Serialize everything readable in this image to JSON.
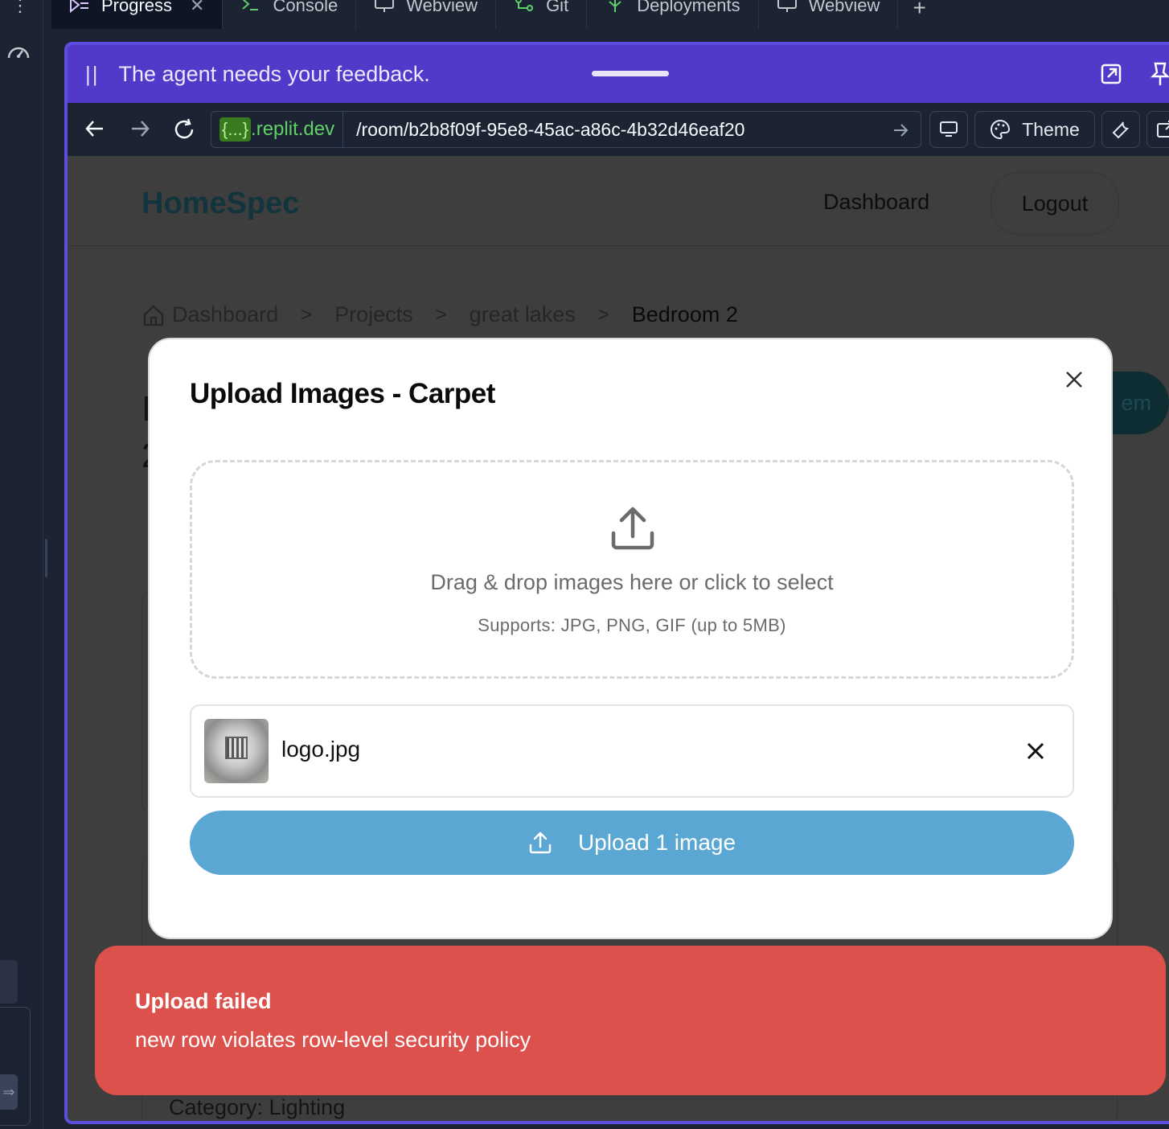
{
  "tabs": [
    {
      "label": "Progress",
      "icon": "progress-icon",
      "active": true,
      "closable": true
    },
    {
      "label": "Console",
      "icon": "console-icon"
    },
    {
      "label": "Webview",
      "icon": "monitor-icon"
    },
    {
      "label": "Git",
      "icon": "git-icon"
    },
    {
      "label": "Deployments",
      "icon": "deployments-icon"
    },
    {
      "label": "Webview",
      "icon": "monitor-icon"
    }
  ],
  "feedback": {
    "message": "The agent needs your feedback."
  },
  "url": {
    "domain_brace": "{...}",
    "domain_suffix": ".replit.dev",
    "path": "/room/b2b8f09f-95e8-45ac-a86c-4b32d46eaf20",
    "theme_label": "Theme"
  },
  "app": {
    "brand": "HomeSpec",
    "nav_dashboard": "Dashboard",
    "logout": "Logout",
    "breadcrumb": [
      "Dashboard",
      "Projects",
      "great lakes",
      "Bedroom 2"
    ],
    "bg_title_fragment": "I",
    "bg_title_fragment2": "2",
    "bg_button_fragment": "em",
    "bg_category": "Category: Lighting"
  },
  "modal": {
    "title": "Upload Images - Carpet",
    "drop_text": "Drag & drop images here or click to select",
    "supports_text": "Supports: JPG, PNG, GIF (up to 5MB)",
    "files": [
      {
        "name": "logo.jpg"
      }
    ],
    "upload_button": "Upload 1 image"
  },
  "toast": {
    "title": "Upload failed",
    "message": "new row violates row-level security policy"
  },
  "colors": {
    "feedback_bar": "#5239c9",
    "frame_border": "#5e4ee0",
    "upload_button": "#5aa7d4",
    "toast": "#dd514d",
    "domain_text": "#5fd068"
  }
}
